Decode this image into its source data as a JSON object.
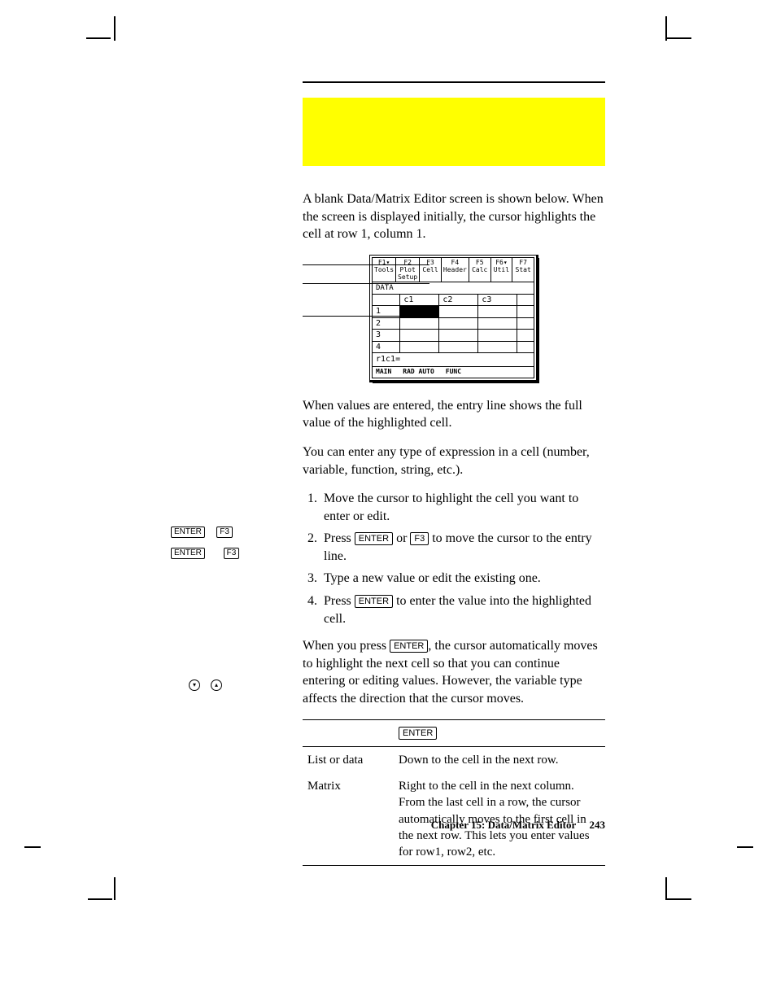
{
  "keys": {
    "enter": "ENTER",
    "f3": "F3"
  },
  "para_intro": "A blank Data/Matrix Editor screen is shown below. When the screen is displayed initially, the cursor highlights the cell at row 1, column 1.",
  "screen": {
    "menus": [
      "F1▾\nTools",
      "F2\nPlot Setup",
      "F3\nCell",
      "F4\nHeader",
      "F5\nCalc",
      "F6▾\nUtil",
      "F7\nStat"
    ],
    "type_label": "DATA",
    "cols": [
      "",
      "c1",
      "c2",
      "c3",
      ""
    ],
    "rows": [
      "1",
      "2",
      "3",
      "4"
    ],
    "entry": "r1c1=",
    "status": [
      "MAIN",
      "RAD AUTO",
      "FUNC"
    ]
  },
  "para_values": "When values are entered, the entry line shows the full value of the highlighted cell.",
  "para_types": "You can enter any type of expression in a cell (number, variable, function, string, etc.).",
  "steps": {
    "s1": "Move the cursor to highlight the cell you want to enter or edit.",
    "s2a": "Press ",
    "s2b": " or ",
    "s2c": " to move the cursor to the entry line.",
    "s3": "Type a new value or edit the existing one.",
    "s4a": "Press ",
    "s4b": " to enter the value into the highlighted cell."
  },
  "para_enter_a": "When you press ",
  "para_enter_b": ", the cursor automatically moves to highlight the next cell so that you can continue entering or editing values. However, the variable type affects the direction that the cursor moves.",
  "table": {
    "r1c1": "List or data",
    "r1c2": "Down to the cell in the next row.",
    "r2c1": "Matrix",
    "r2c2": "Right to the cell in the next column. From the last cell in a row, the cursor automatically moves to the first cell in the next row. This lets you enter values for row1, row2, etc."
  },
  "footer": {
    "chapter": "Chapter 15: Data/Matrix Editor",
    "page": "243"
  }
}
